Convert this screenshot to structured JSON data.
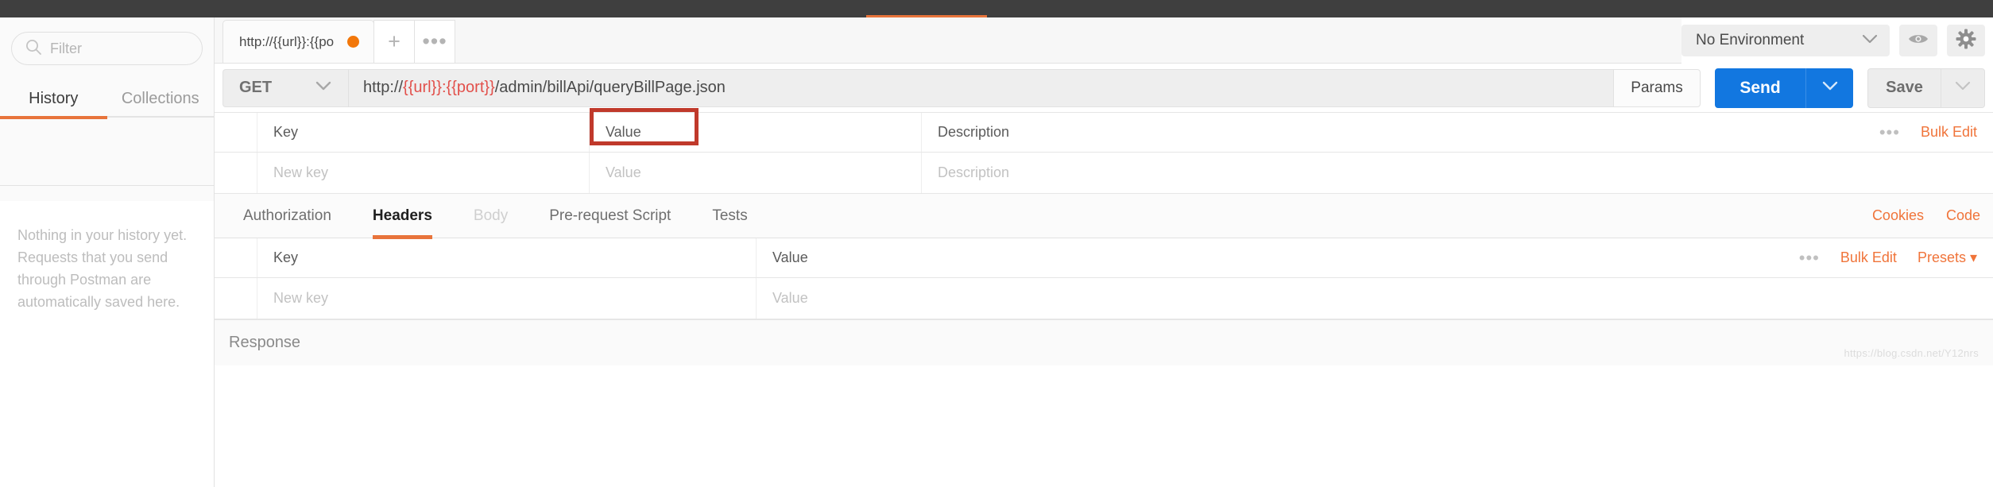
{
  "sidebar": {
    "search": {
      "placeholder": "Filter",
      "icon": "search-icon"
    },
    "tabs": [
      {
        "label": "History",
        "active": true
      },
      {
        "label": "Collections",
        "active": false
      }
    ],
    "empty_state": "Nothing in your history yet. Requests that you send through Postman are automatically saved here."
  },
  "tabstrip": {
    "request_tab_label": "http://{{url}}:{{port}}/a",
    "unsaved_dot_color": "#f2770a",
    "new_tab_glyph": "+",
    "more_glyph": "•••"
  },
  "environment": {
    "selected": "No Environment",
    "caret_icon": "chevron-down-icon",
    "eye_icon": "eye-icon",
    "gear_icon": "gear-icon"
  },
  "request": {
    "method": "GET",
    "method_caret": "chevron-down-icon",
    "url_prefix": "http://",
    "url_var_host": "{{url}}",
    "url_colon": ":",
    "url_var_port": "{{port}}",
    "url_path": "/admin/billApi/queryBillPage.json",
    "params_label": "Params",
    "send_label": "Send",
    "send_caret": "chevron-down-icon",
    "save_label": "Save",
    "save_caret": "chevron-down-icon",
    "annotation_color": "#c0392b"
  },
  "params_table": {
    "headers": {
      "key": "Key",
      "value": "Value",
      "description": "Description"
    },
    "new_row": {
      "key": "New key",
      "value": "Value",
      "description": "Description"
    },
    "more_glyph": "•••",
    "bulk_edit": "Bulk Edit"
  },
  "section_tabs": [
    {
      "label": "Authorization",
      "state": "normal"
    },
    {
      "label": "Headers",
      "state": "active"
    },
    {
      "label": "Body",
      "state": "disabled"
    },
    {
      "label": "Pre-request Script",
      "state": "normal"
    },
    {
      "label": "Tests",
      "state": "normal"
    }
  ],
  "section_right": {
    "cookies": "Cookies",
    "code": "Code"
  },
  "headers_table": {
    "headers": {
      "key": "Key",
      "value": "Value"
    },
    "new_row": {
      "key": "New key",
      "value": "Value"
    },
    "more_glyph": "•••",
    "bulk_edit": "Bulk Edit",
    "presets": "Presets ▾"
  },
  "response": {
    "label": "Response",
    "watermark": "https://blog.csdn.net/Y12nrs"
  },
  "colors": {
    "accent_orange": "#e8743b",
    "send_blue": "#1277e0",
    "variable_red": "#e2504b"
  }
}
